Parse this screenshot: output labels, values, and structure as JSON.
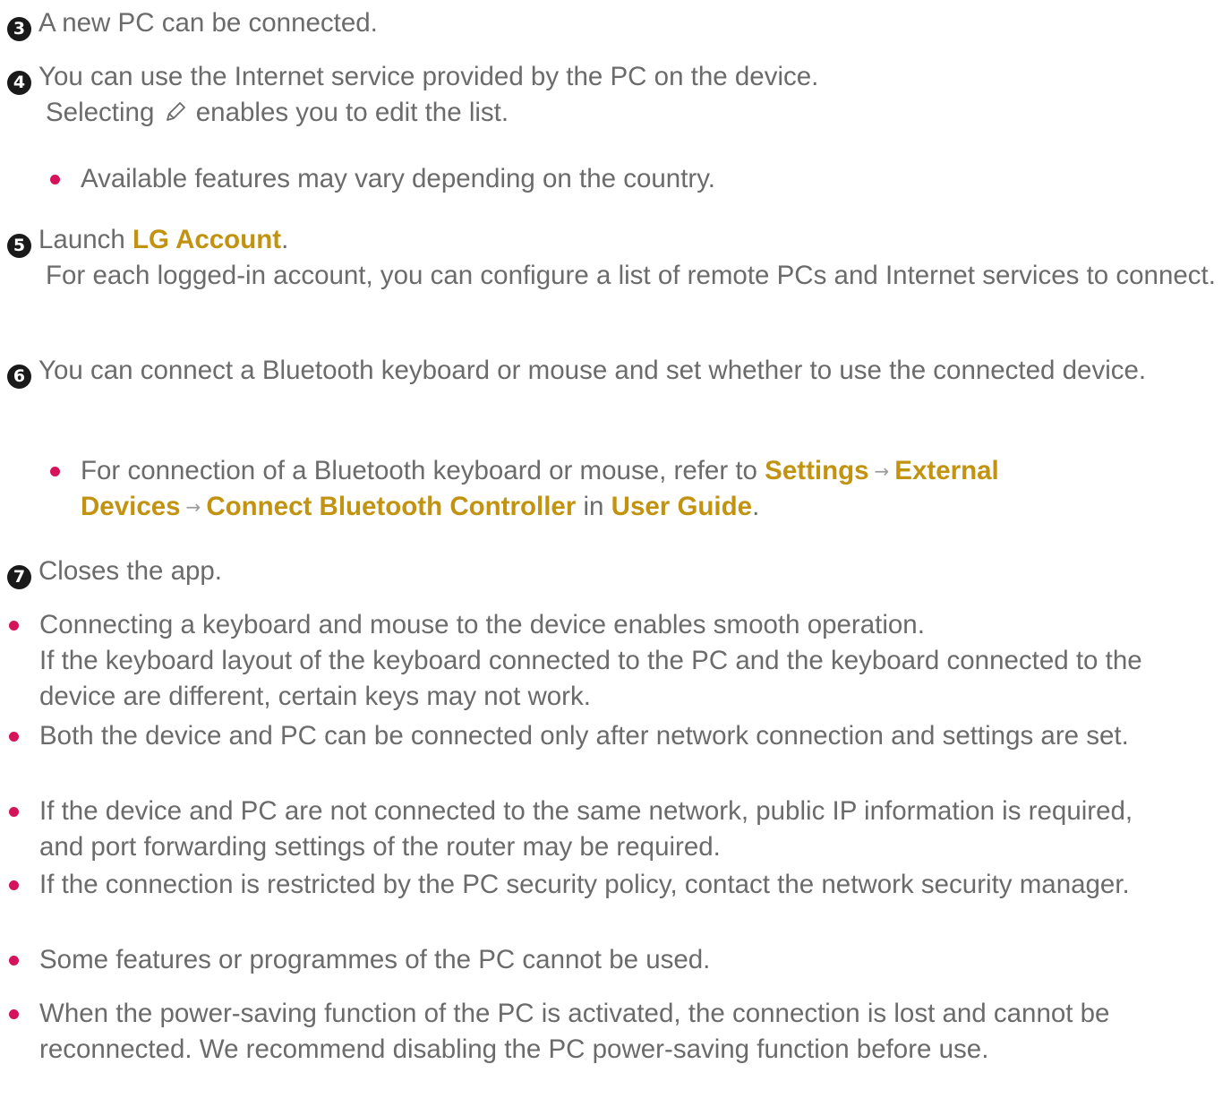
{
  "steps": [
    {
      "number": "3",
      "text": "A new PC can be connected."
    },
    {
      "number": "4",
      "line1": "You can use the Internet service provided by the PC on the device.",
      "line2_pre": "Selecting",
      "line2_post": "enables you to edit the list.",
      "note": "Available features may vary depending on the country."
    },
    {
      "number": "5",
      "pre": "Launch",
      "link": "LG Account",
      "post": ".",
      "desc": "For each logged-in account, you can configure a list of remote PCs and Internet services to connect."
    },
    {
      "number": "6",
      "text": "You can connect a Bluetooth keyboard or mouse and set whether to use the connected device.",
      "note_pre": "For connection of a Bluetooth keyboard or mouse, refer to",
      "path1": "Settings",
      "path2": "External Devices",
      "path3": "Connect Bluetooth Controller",
      "in_word": "in",
      "guide": "User Guide",
      "period": "."
    },
    {
      "number": "7",
      "text": "Closes the app."
    }
  ],
  "notes": [
    {
      "line1": "Connecting a keyboard and mouse to the device enables smooth operation.",
      "line2": "If the keyboard layout of the keyboard connected to the PC and the keyboard connected to the device are different, certain keys may not work."
    },
    {
      "text": "Both the device and PC can be connected only after network connection and settings are set."
    },
    {
      "text": "If the device and PC are not connected to the same network, public IP information is required, and port forwarding settings of the router may be required."
    },
    {
      "text": "If the connection is restricted by the PC security policy, contact the network security manager."
    },
    {
      "text": "Some features or programmes of the PC cannot be used."
    },
    {
      "text": "When the power-saving function of the PC is activated, the connection is lost and cannot be reconnected. We recommend disabling the PC power-saving function before use."
    }
  ],
  "icons": {
    "arrow": "→",
    "edit": "pencil-icon"
  },
  "colors": {
    "link": "#c29310",
    "bullet": "#d4135a",
    "badge": "#1a1a1a",
    "text": "#6b6b6b"
  }
}
